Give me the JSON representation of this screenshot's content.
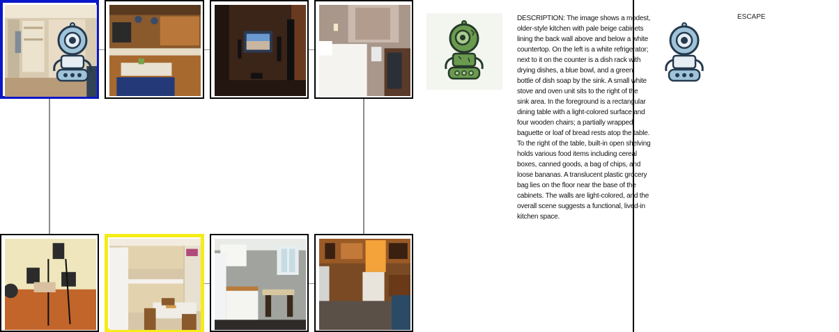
{
  "description": {
    "text": "DESCRIPTION: The image shows a modest, older-style kitchen with pale beige cabinets lining the back wall above and below a white countertop. On the left is a white refrigerator; next to it on the counter is a dish rack with drying dishes, a blue bowl, and a green bottle of dish soap by the sink. A small white stove and oven unit sits to the right of the sink area. In the foreground is a rectangular dining table with a light-colored surface and four wooden chairs; a partially wrapped baguette or loaf of bread rests atop the table. To the right of the table, built-in open shelving holds various food items including cereal boxes, canned goods, a bag of chips, and loose bananas. A translucent plastic grocery bag lies on the floor near the base of the cabinets. The walls are light-colored, and the overall scene suggests a functional, lived-in kitchen space."
  },
  "escape": {
    "label": "ESCAPE"
  },
  "rooms": [
    {
      "name": "closet"
    },
    {
      "name": "kitchen-island"
    },
    {
      "name": "home-theater"
    },
    {
      "name": "bedroom"
    },
    {
      "name": "music-studio"
    },
    {
      "name": "kitchen-dining"
    },
    {
      "name": "white-kitchen"
    },
    {
      "name": "wood-kitchen"
    }
  ],
  "colors": {
    "current_border": "#0a17c8",
    "target_border": "#f5ec1a",
    "robot_green": "#6a9a4e",
    "robot_blue": "#9fc3d8",
    "outline": "#253a4f"
  }
}
